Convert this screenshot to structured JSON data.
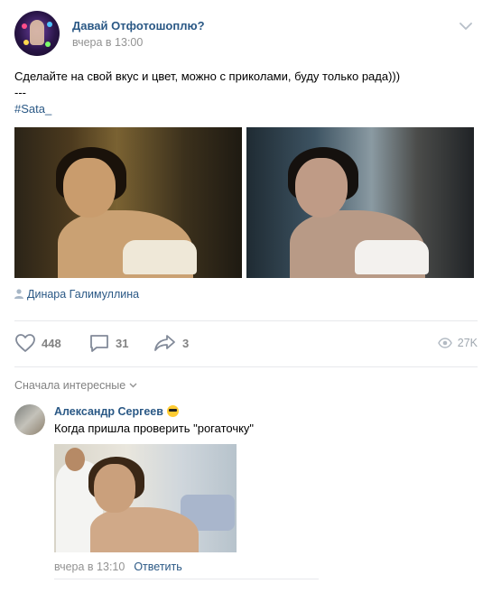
{
  "post": {
    "group_name": "Давай Отфотошоплю?",
    "time": "вчера в 13:00",
    "text_line1": "Сделайте на свой вкус и цвет, можно с приколами, буду только рада)))",
    "text_line2": "---",
    "hashtag": "#Sata_",
    "author": "Динара Галимуллина",
    "photos": [
      {
        "name": "original-photo",
        "icon": "photo"
      },
      {
        "name": "edited-photo",
        "icon": "photo"
      }
    ]
  },
  "actions": {
    "likes": "448",
    "comments": "31",
    "shares": "3",
    "views": "27K"
  },
  "comments_section": {
    "sort_label": "Сначала интересные",
    "comments": [
      {
        "author": "Александр Сергеев",
        "text": "Когда пришла проверить \"рогаточку\"",
        "time": "вчера в 13:10",
        "reply_label": "Ответить"
      }
    ]
  },
  "colors": {
    "link": "#2a5885",
    "muted": "#939393",
    "action": "#828282",
    "divider": "#e7e8ec"
  }
}
